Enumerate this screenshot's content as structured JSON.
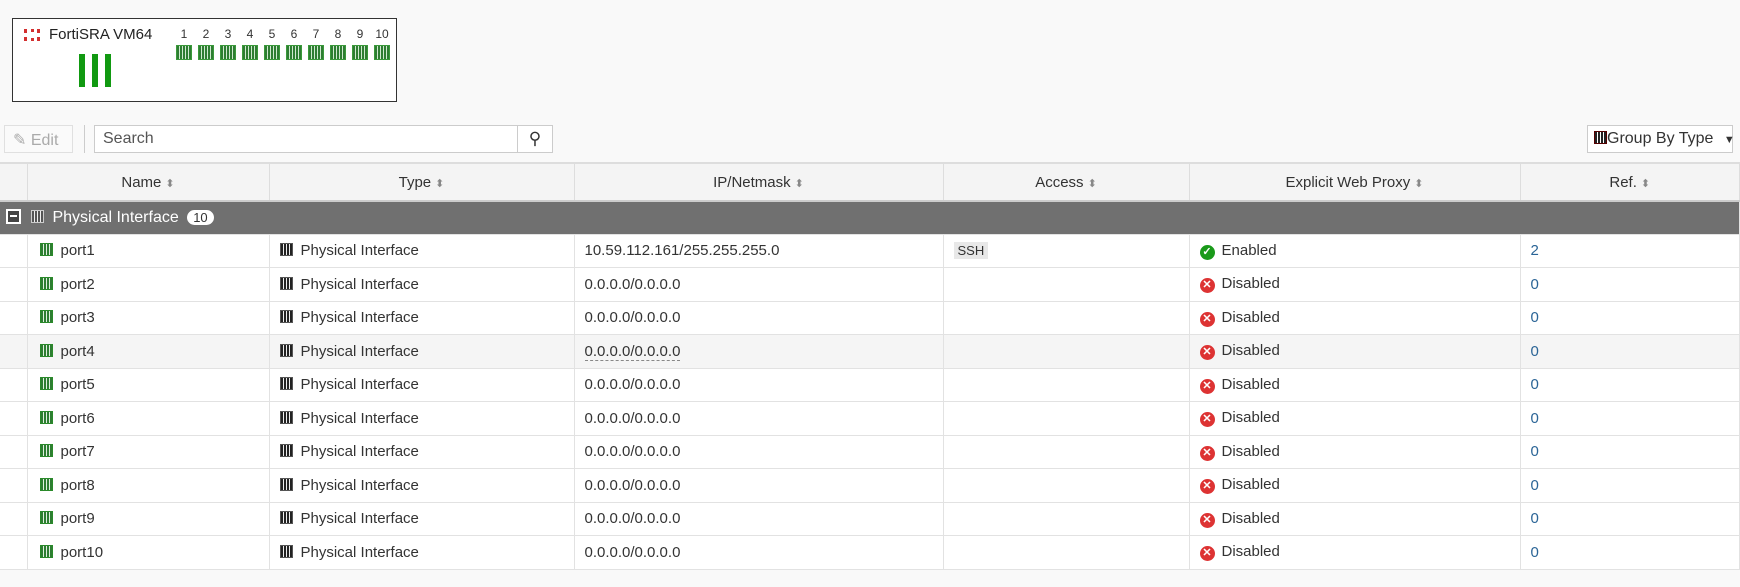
{
  "device": {
    "title": "FortiSRA VM64",
    "ports": [
      "1",
      "2",
      "3",
      "4",
      "5",
      "6",
      "7",
      "8",
      "9",
      "10"
    ]
  },
  "toolbar": {
    "edit_label": "Edit",
    "search_placeholder": "Search",
    "group_by_label": "Group By Type"
  },
  "columns": [
    "Name",
    "Type",
    "IP/Netmask",
    "Access",
    "Explicit Web Proxy",
    "Ref."
  ],
  "group": {
    "label": "Physical Interface",
    "count": "10"
  },
  "rows": [
    {
      "name": "port1",
      "type": "Physical Interface",
      "ip": "10.59.112.161/255.255.255.0",
      "access": "SSH",
      "proxy": "Enabled",
      "ref": "2"
    },
    {
      "name": "port2",
      "type": "Physical Interface",
      "ip": "0.0.0.0/0.0.0.0",
      "access": "",
      "proxy": "Disabled",
      "ref": "0"
    },
    {
      "name": "port3",
      "type": "Physical Interface",
      "ip": "0.0.0.0/0.0.0.0",
      "access": "",
      "proxy": "Disabled",
      "ref": "0"
    },
    {
      "name": "port4",
      "type": "Physical Interface",
      "ip": "0.0.0.0/0.0.0.0",
      "access": "",
      "proxy": "Disabled",
      "ref": "0"
    },
    {
      "name": "port5",
      "type": "Physical Interface",
      "ip": "0.0.0.0/0.0.0.0",
      "access": "",
      "proxy": "Disabled",
      "ref": "0"
    },
    {
      "name": "port6",
      "type": "Physical Interface",
      "ip": "0.0.0.0/0.0.0.0",
      "access": "",
      "proxy": "Disabled",
      "ref": "0"
    },
    {
      "name": "port7",
      "type": "Physical Interface",
      "ip": "0.0.0.0/0.0.0.0",
      "access": "",
      "proxy": "Disabled",
      "ref": "0"
    },
    {
      "name": "port8",
      "type": "Physical Interface",
      "ip": "0.0.0.0/0.0.0.0",
      "access": "",
      "proxy": "Disabled",
      "ref": "0"
    },
    {
      "name": "port9",
      "type": "Physical Interface",
      "ip": "0.0.0.0/0.0.0.0",
      "access": "",
      "proxy": "Disabled",
      "ref": "0"
    },
    {
      "name": "port10",
      "type": "Physical Interface",
      "ip": "0.0.0.0/0.0.0.0",
      "access": "",
      "proxy": "Disabled",
      "ref": "0"
    }
  ]
}
